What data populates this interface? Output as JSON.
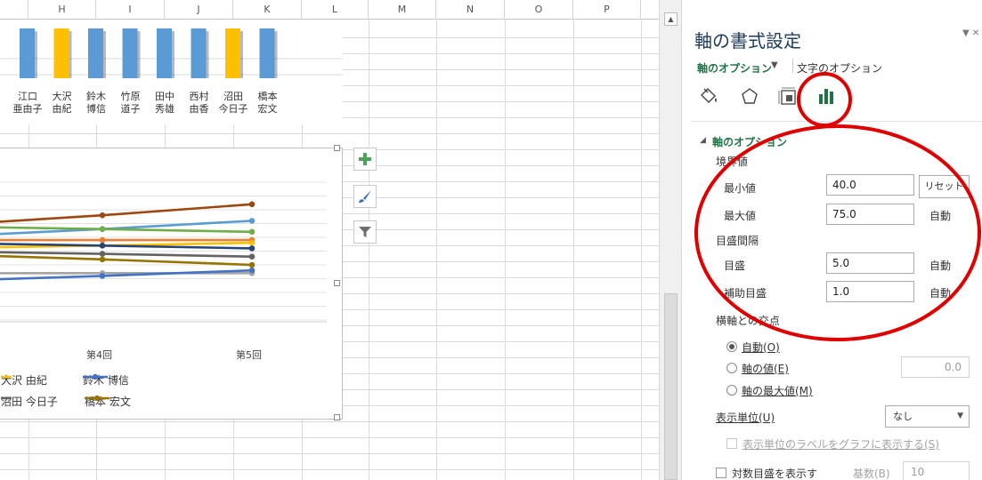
{
  "sheet": {
    "columns": [
      "H",
      "I",
      "J",
      "K",
      "L",
      "M",
      "N",
      "O",
      "P"
    ],
    "bar_labels": [
      {
        "line1": "江口",
        "line2": "亜由子"
      },
      {
        "line1": "大沢",
        "line2": "由紀"
      },
      {
        "line1": "鈴木",
        "line2": "博信"
      },
      {
        "line1": "竹原",
        "line2": "道子"
      },
      {
        "line1": "田中",
        "line2": "秀雄"
      },
      {
        "line1": "西村",
        "line2": "由香"
      },
      {
        "line1": "沼田",
        "line2": "今日子"
      },
      {
        "line1": "橋本",
        "line2": "宏文"
      }
    ],
    "bar_colors": [
      "#5b9bd5",
      "#ffc000",
      "#5b9bd5",
      "#5b9bd5",
      "#5b9bd5",
      "#5b9bd5",
      "#ffc000",
      "#5b9bd5"
    ],
    "chart_buttons": [
      "add-element-icon",
      "style-brush-icon",
      "filter-icon"
    ]
  },
  "chart_data": {
    "type": "line",
    "categories": [
      "第4回",
      "第5回"
    ],
    "legend_rows": [
      [
        {
          "name": "大沢 由紀",
          "color": "#ffc000"
        },
        {
          "name": "鈴木 博信",
          "color": "#4472c4"
        }
      ],
      [
        {
          "name": "沼田 今日子",
          "color": "#636363"
        },
        {
          "name": "橋本 宏文",
          "color": "#997300"
        }
      ]
    ],
    "series": [
      {
        "color": "#9e480e",
        "values": [
          69.0,
          71.0
        ]
      },
      {
        "color": "#5b9bd5",
        "values": [
          66.5,
          68.0
        ]
      },
      {
        "color": "#70ad47",
        "values": [
          66.5,
          66.0
        ]
      },
      {
        "color": "#ed7d31",
        "values": [
          64.5,
          64.5
        ]
      },
      {
        "color": "#ffc000",
        "values": [
          63.5,
          64.0
        ]
      },
      {
        "color": "#264478",
        "values": [
          63.5,
          63.0
        ]
      },
      {
        "color": "#636363",
        "values": [
          62.0,
          61.5
        ]
      },
      {
        "color": "#997300",
        "values": [
          61.0,
          60.0
        ]
      },
      {
        "color": "#a5a5a5",
        "values": [
          58.5,
          58.5
        ]
      },
      {
        "color": "#4472c4",
        "values": [
          58.0,
          59.0
        ]
      }
    ],
    "ylim": [
      50,
      75
    ],
    "grid": true
  },
  "pane": {
    "title": "軸の書式設定",
    "close_glyph": "▼ ✕",
    "tab_axis_options": "軸のオプション",
    "tab_caret": "▼",
    "tab_text_options": "文字のオプション",
    "section_caret": "◢",
    "section_title": "軸のオプション",
    "bounds_label": "境界値",
    "min_label": "最小値",
    "min_value": "40.0",
    "reset_label": "リセット",
    "max_label": "最大値",
    "max_value": "75.0",
    "max_auto": "自動",
    "units_label": "目盛間隔",
    "major_label": "目盛",
    "major_value": "5.0",
    "major_auto": "自動",
    "minor_label": "補助目盛",
    "minor_value": "1.0",
    "minor_auto": "自動",
    "crosses_label": "横軸との交点",
    "radio_auto": "自動(O)",
    "radio_value": "軸の値(E)",
    "radio_value_box": "0.0",
    "radio_max": "軸の最大値(M)",
    "display_units_label": "表示単位(U)",
    "display_units_value": "なし",
    "show_units_label": "表示単位のラベルをグラフに表示する(S)",
    "log_label": "対数目盛を表示す",
    "base_label": "基数(B)",
    "base_value": "10"
  },
  "colors": {
    "accent_green": "#217346",
    "annotation_red": "#e00000",
    "pane_title": "#1e3a5a"
  }
}
